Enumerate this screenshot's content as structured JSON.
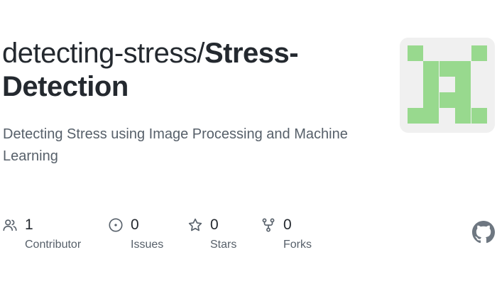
{
  "repo": {
    "owner": "detecting-stress/",
    "name": "Stress-Detection",
    "description": "Detecting Stress using Image Processing and Machine Learning"
  },
  "identicon": {
    "foreground": "#98d98e",
    "background": "#f0f0f0"
  },
  "stats": [
    {
      "count": "1",
      "label": "Contributor",
      "icon": "people-icon"
    },
    {
      "count": "0",
      "label": "Issues",
      "icon": "issue-opened-icon"
    },
    {
      "count": "0",
      "label": "Stars",
      "icon": "star-icon"
    },
    {
      "count": "0",
      "label": "Forks",
      "icon": "repo-forked-icon"
    }
  ],
  "colors": {
    "text_primary": "#24292f",
    "text_secondary": "#57606a",
    "icon": "#57606a",
    "github_mark": "#6e7781"
  }
}
